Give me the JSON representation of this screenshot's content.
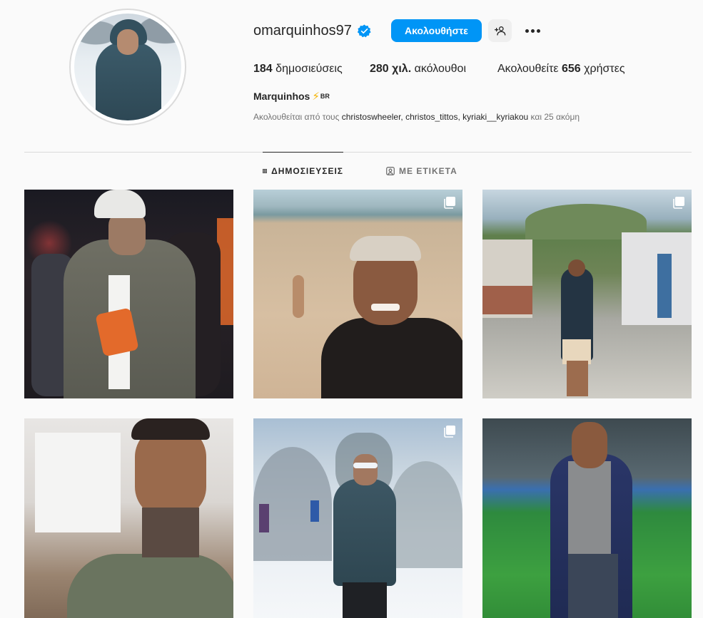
{
  "profile": {
    "username": "omarquinhos97",
    "verified": true,
    "follow_label": "Ακολουθήστε",
    "stats": {
      "posts_count": "184",
      "posts_label": "δημοσιεύσεις",
      "followers_count": "280 χιλ.",
      "followers_label": "ακόλουθοι",
      "following_prefix": "Ακολουθείτε",
      "following_count": "656",
      "following_suffix": "χρήστες"
    },
    "full_name": "Marquinhos",
    "name_emoji": "⚡",
    "name_tag": "BR",
    "followed_by": {
      "prefix": "Ακολουθείται από τους",
      "users": [
        "christoswheeler,",
        "christos_tittos,",
        "kyriaki__kyriakou"
      ],
      "suffix": "και 25 ακόμη"
    }
  },
  "tabs": [
    {
      "label": "ΔΗΜΟΣΙΕΥΣΕΙΣ",
      "icon": "grid-icon",
      "active": true
    },
    {
      "label": "ΜΕ ΕΤΙΚΕΤΑ",
      "icon": "tagged-icon",
      "active": false
    }
  ],
  "posts": [
    {
      "scene": "night-club",
      "multi": false
    },
    {
      "scene": "beach-selfie",
      "multi": true
    },
    {
      "scene": "favela-street",
      "multi": true
    },
    {
      "scene": "indoor-selfie",
      "multi": false
    },
    {
      "scene": "snow-mountain",
      "multi": true
    },
    {
      "scene": "stadium-pitch",
      "multi": false
    }
  ],
  "colors": {
    "accent": "#0095f6",
    "verified": "#0095f6",
    "text": "#262626",
    "muted": "#737373",
    "background": "#fafafa"
  }
}
